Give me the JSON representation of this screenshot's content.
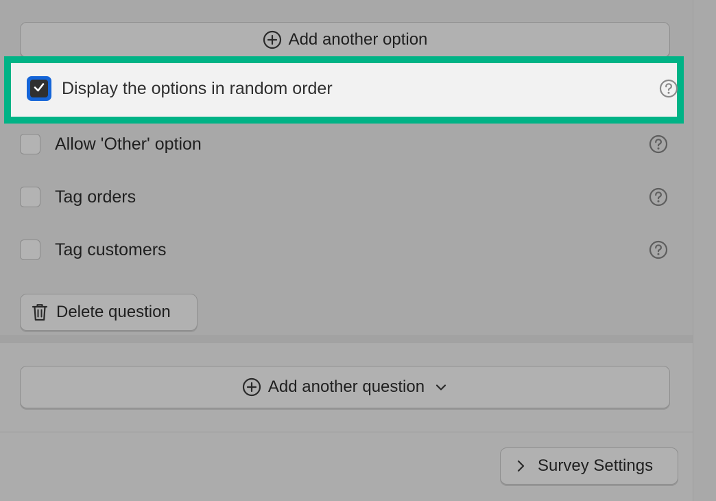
{
  "question": {
    "add_option_label": "Add another option",
    "options": [
      {
        "label": "Display the options in random order",
        "checked": true,
        "highlighted": true
      },
      {
        "label": "Allow 'Other' option",
        "checked": false
      },
      {
        "label": "Tag orders",
        "checked": false
      },
      {
        "label": "Tag customers",
        "checked": false
      }
    ],
    "delete_label": "Delete question"
  },
  "footer": {
    "add_question_label": "Add another question",
    "survey_settings_label": "Survey Settings"
  },
  "colors": {
    "highlight": "#00b386",
    "focus_ring": "#1565d8",
    "overlay_bg": "#a8a8a8"
  },
  "icons": {
    "add_option": "plus-circle-icon",
    "help": "question-circle-icon",
    "delete": "trash-icon",
    "add_question": "plus-circle-icon",
    "dropdown": "chevron-down-icon",
    "settings": "chevron-right-icon",
    "check": "checkmark-icon"
  }
}
